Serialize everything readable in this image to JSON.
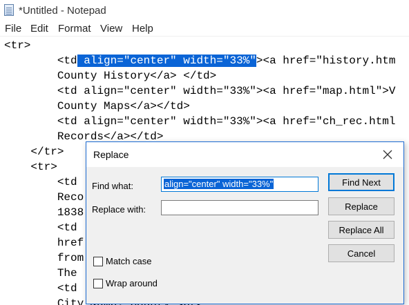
{
  "window": {
    "title": "*Untitled - Notepad"
  },
  "menu": [
    "File",
    "Edit",
    "Format",
    "View",
    "Help"
  ],
  "editor": {
    "lines": [
      "<tr>",
      "        <td",
      "        County History</a> </td>",
      "        <td align=\"center\" width=\"33%\"><a href=\"map.html\">V",
      "        County Maps</a></td>",
      "        <td align=\"center\" width=\"33%\"><a href=\"ch_rec.html",
      "        Records</a></td>",
      "    </tr>",
      "    <tr>",
      "        <td",
      "        Reco",
      "        1838",
      "        <td",
      "        href",
      "        from",
      "        The",
      "        <td",
      "        City &amp; County <br>"
    ],
    "line1_selected": " align=\"center\" width=\"33%\"",
    "line1_after": "><a href=\"history.htm"
  },
  "dialog": {
    "title": "Replace",
    "find_label": "Find what:",
    "find_value": "align=\"center\" width=\"33%\"",
    "replace_label": "Replace with:",
    "replace_value": "",
    "buttons": {
      "find_next": "Find Next",
      "replace": "Replace",
      "replace_all": "Replace All",
      "cancel": "Cancel"
    },
    "options": {
      "match_case": "Match case",
      "wrap_around": "Wrap around"
    }
  }
}
